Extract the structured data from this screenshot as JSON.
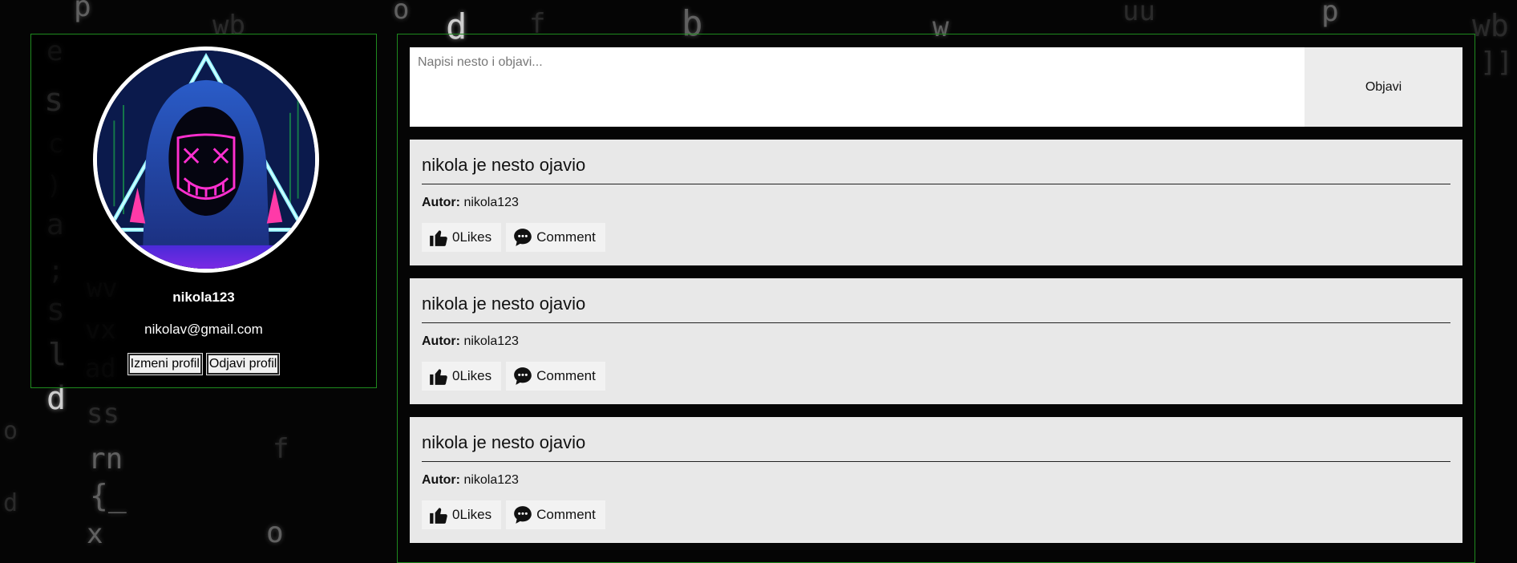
{
  "profile": {
    "username": "nikola123",
    "email": "nikolav@gmail.com",
    "edit_label": "Izmeni profil",
    "logout_label": "Odjavi profil"
  },
  "composer": {
    "placeholder": "Napisi nesto i objavi...",
    "submit_label": "Objavi"
  },
  "posts": [
    {
      "title": "nikola je nesto ojavio",
      "author_label": "Autor:",
      "author": "nikola123",
      "likes_label": "0Likes",
      "comment_label": "Comment"
    },
    {
      "title": "nikola je nesto ojavio",
      "author_label": "Autor:",
      "author": "nikola123",
      "likes_label": "0Likes",
      "comment_label": "Comment"
    },
    {
      "title": "nikola je nesto ojavio",
      "author_label": "Autor:",
      "author": "nikola123",
      "likes_label": "0Likes",
      "comment_label": "Comment"
    }
  ],
  "colors": {
    "border_accent": "#1e8a1e",
    "post_bg": "#e8e8e8",
    "page_bg": "#050505"
  },
  "icons": [
    "like-thumb-icon",
    "comment-bubble-icon"
  ]
}
